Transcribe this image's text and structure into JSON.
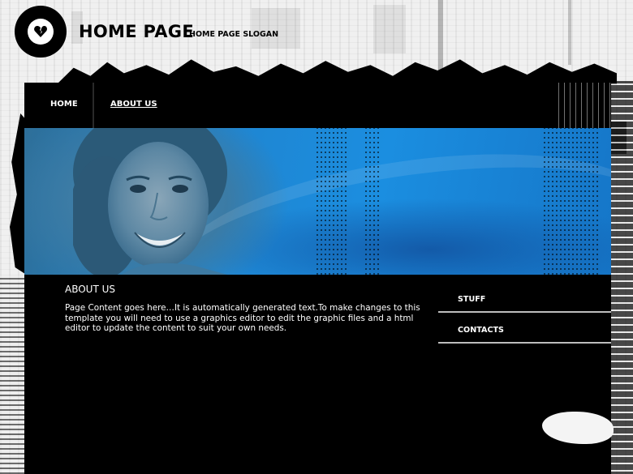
{
  "header": {
    "title": "HOME PAGE",
    "slogan": "HOME PAGE SLOGAN",
    "logo_icon": "broken-heart-icon"
  },
  "nav": {
    "items": [
      {
        "label": "HOME",
        "active": false
      },
      {
        "label": "ABOUT US",
        "active": true
      }
    ]
  },
  "banner": {
    "image": "smiling-woman-photo"
  },
  "content": {
    "title": "ABOUT US",
    "body": "Page Content goes here…It is automatically generated text.To make changes to this template you will need to use a graphics editor to edit the graphic files and a html editor to update the content to suit your own needs."
  },
  "sidebar": {
    "links": [
      {
        "label": "STUFF"
      },
      {
        "label": "CONTACTS"
      }
    ]
  },
  "colors": {
    "panel": "#000000",
    "banner_blue": "#1b8ee0",
    "text": "#ffffff"
  }
}
